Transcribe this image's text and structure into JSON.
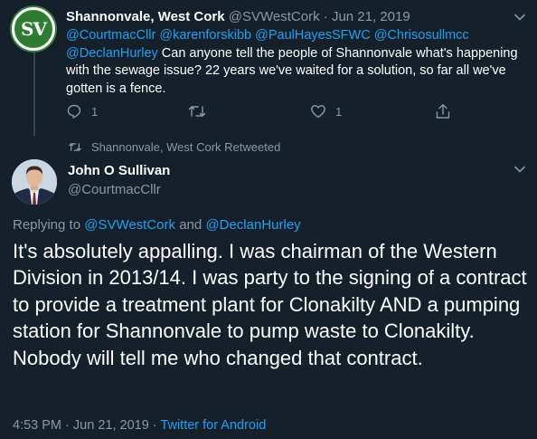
{
  "parent_tweet": {
    "avatar_text": "SV",
    "display_name": "Shannonvale, West Cork",
    "handle": "@SVWestCork",
    "separator": "·",
    "date": "Jun 21, 2019",
    "mentions": [
      "@CourtmacCllr",
      "@karenforskibb",
      "@PaulHayesSFWC",
      "@Chrisosullmcc",
      "@DeclanHurley"
    ],
    "body": "Can anyone tell the people of Shannonvale what's happening with the sewage issue? 22 years we've waited for a solution, so far all we've gotten is a fence.",
    "reply_count": "1",
    "like_count": "1",
    "icons": [
      "reply-icon",
      "retweet-icon",
      "like-icon",
      "share-icon",
      "chevron-down-icon"
    ]
  },
  "retweet_note": {
    "text": "Shannonvale, West Cork Retweeted"
  },
  "focus_tweet": {
    "display_name": "John O Sullivan",
    "handle": "@CourtmacCllr",
    "replying_prefix": "Replying to",
    "replying_to": [
      "@SVWestCork",
      "@DeclanHurley"
    ],
    "replying_joiner": "and",
    "text": "It's absolutely appalling. I was chairman of the Western Division in 2013/14. I was party to the signing of a contract to provide a treatment plant for Clonakilty AND a pumping station for Shannonvale to pump waste to Clonakilty. Nobody will tell me who changed that contract.",
    "time": "4:53 PM",
    "separator": "·",
    "date": "Jun 21, 2019",
    "source": "Twitter for Android"
  },
  "colors": {
    "background": "#15202b",
    "accent": "#1da1f2",
    "muted": "#8899a6",
    "text": "#ffffff"
  }
}
